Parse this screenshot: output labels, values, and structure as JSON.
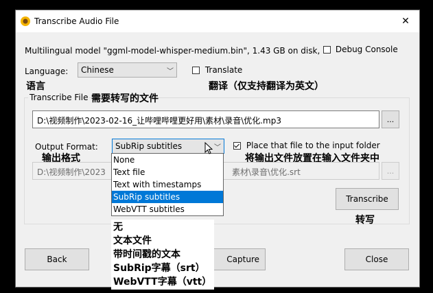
{
  "window": {
    "title": "Transcribe Audio File",
    "close_glyph": "✕"
  },
  "model_info": "Multilingual model \"ggml-model-whisper-medium.bin\", 1.43 GB on disk,",
  "debug_console_label": "Debug Console",
  "language": {
    "label": "Language:",
    "value": "Chinese",
    "annotation": "语言"
  },
  "translate": {
    "label": "Translate",
    "annotation": "翻译（仅支持翻译为英文）"
  },
  "transcribe_file": {
    "group_label": "Transcribe File",
    "annotation": "需要转写的文件",
    "path": "D:\\视频制作\\2023-02-16_让哔哩哔哩更好用\\素材\\录音\\优化.mp3",
    "browse_label": "..."
  },
  "output_format": {
    "label": "Output Format:",
    "annotation": "输出格式",
    "value": "SubRip subtitles",
    "options": [
      "None",
      "Text file",
      "Text with timestamps",
      "SubRip subtitles",
      "WebVTT subtitles"
    ],
    "selected_index": 3,
    "options_cn": [
      "无",
      "文本文件",
      "带时间戳的文本",
      "SubRip字幕（srt）",
      "WebVTT字幕（vtt）"
    ]
  },
  "place_output": {
    "label": "Place that file to the input folder",
    "annotation": "将输出文件放置在输入文件夹中",
    "checked": true
  },
  "output_path": {
    "visible_prefix": "D:\\视频制作\\2023",
    "visible_suffix": "素材\\录音\\优化.srt",
    "browse_label": "..."
  },
  "transcribe_button": {
    "label": "Transcribe",
    "annotation": "转写"
  },
  "footer": {
    "back_label": "Back",
    "capture_label": "Capture",
    "close_label": "Close"
  },
  "icons": {
    "app": "sunflower-icon",
    "close": "close-icon",
    "chevron": "chevron-down-icon",
    "cursor": "mouse-cursor-icon"
  },
  "colors": {
    "selection": "#0078d7",
    "dialog_bg": "#f0f0f0"
  }
}
